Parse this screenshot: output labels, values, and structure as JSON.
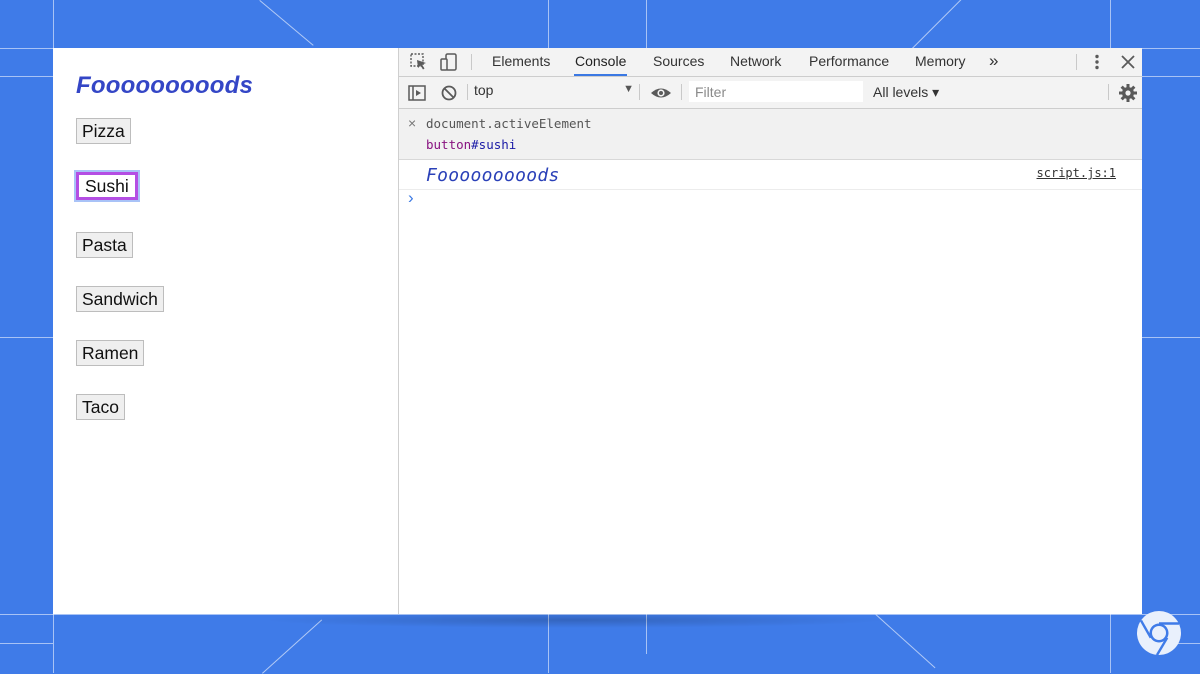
{
  "page": {
    "heading": "Fooooooooods",
    "buttons": [
      {
        "label": "Pizza"
      },
      {
        "label": "Sushi",
        "focused": true
      },
      {
        "label": "Pasta"
      },
      {
        "label": "Sandwich"
      },
      {
        "label": "Ramen"
      },
      {
        "label": "Taco"
      }
    ]
  },
  "devtools": {
    "tabs": [
      "Elements",
      "Console",
      "Sources",
      "Network",
      "Performance",
      "Memory"
    ],
    "active_tab": "Console",
    "more_tabs_glyph": "»",
    "toolbar": {
      "context": "top",
      "filter_placeholder": "Filter",
      "levels": "All levels ▾"
    },
    "console": {
      "command": "document.activeElement",
      "result_tag": "button",
      "result_id": "#sushi",
      "log_message": "Fooooooooods",
      "log_source": "script.js:1",
      "prompt_glyph": "›"
    }
  },
  "icons": {
    "inspect": "inspect-element-icon",
    "device": "device-toolbar-icon",
    "more": "kebab-menu-icon",
    "close": "close-icon",
    "sidebar": "show-sidebar-icon",
    "clear": "clear-console-icon",
    "eye": "live-expression-icon",
    "settings": "gear-icon",
    "chrome": "chrome-logo-icon"
  },
  "colors": {
    "background": "#3f7be8",
    "heading": "#3446c6",
    "focus_ring": "#b44ee3",
    "active_tab": "#3a78e3",
    "log_text": "#2a40b8",
    "result_tag": "#881280",
    "result_id": "#1a1aa6"
  }
}
